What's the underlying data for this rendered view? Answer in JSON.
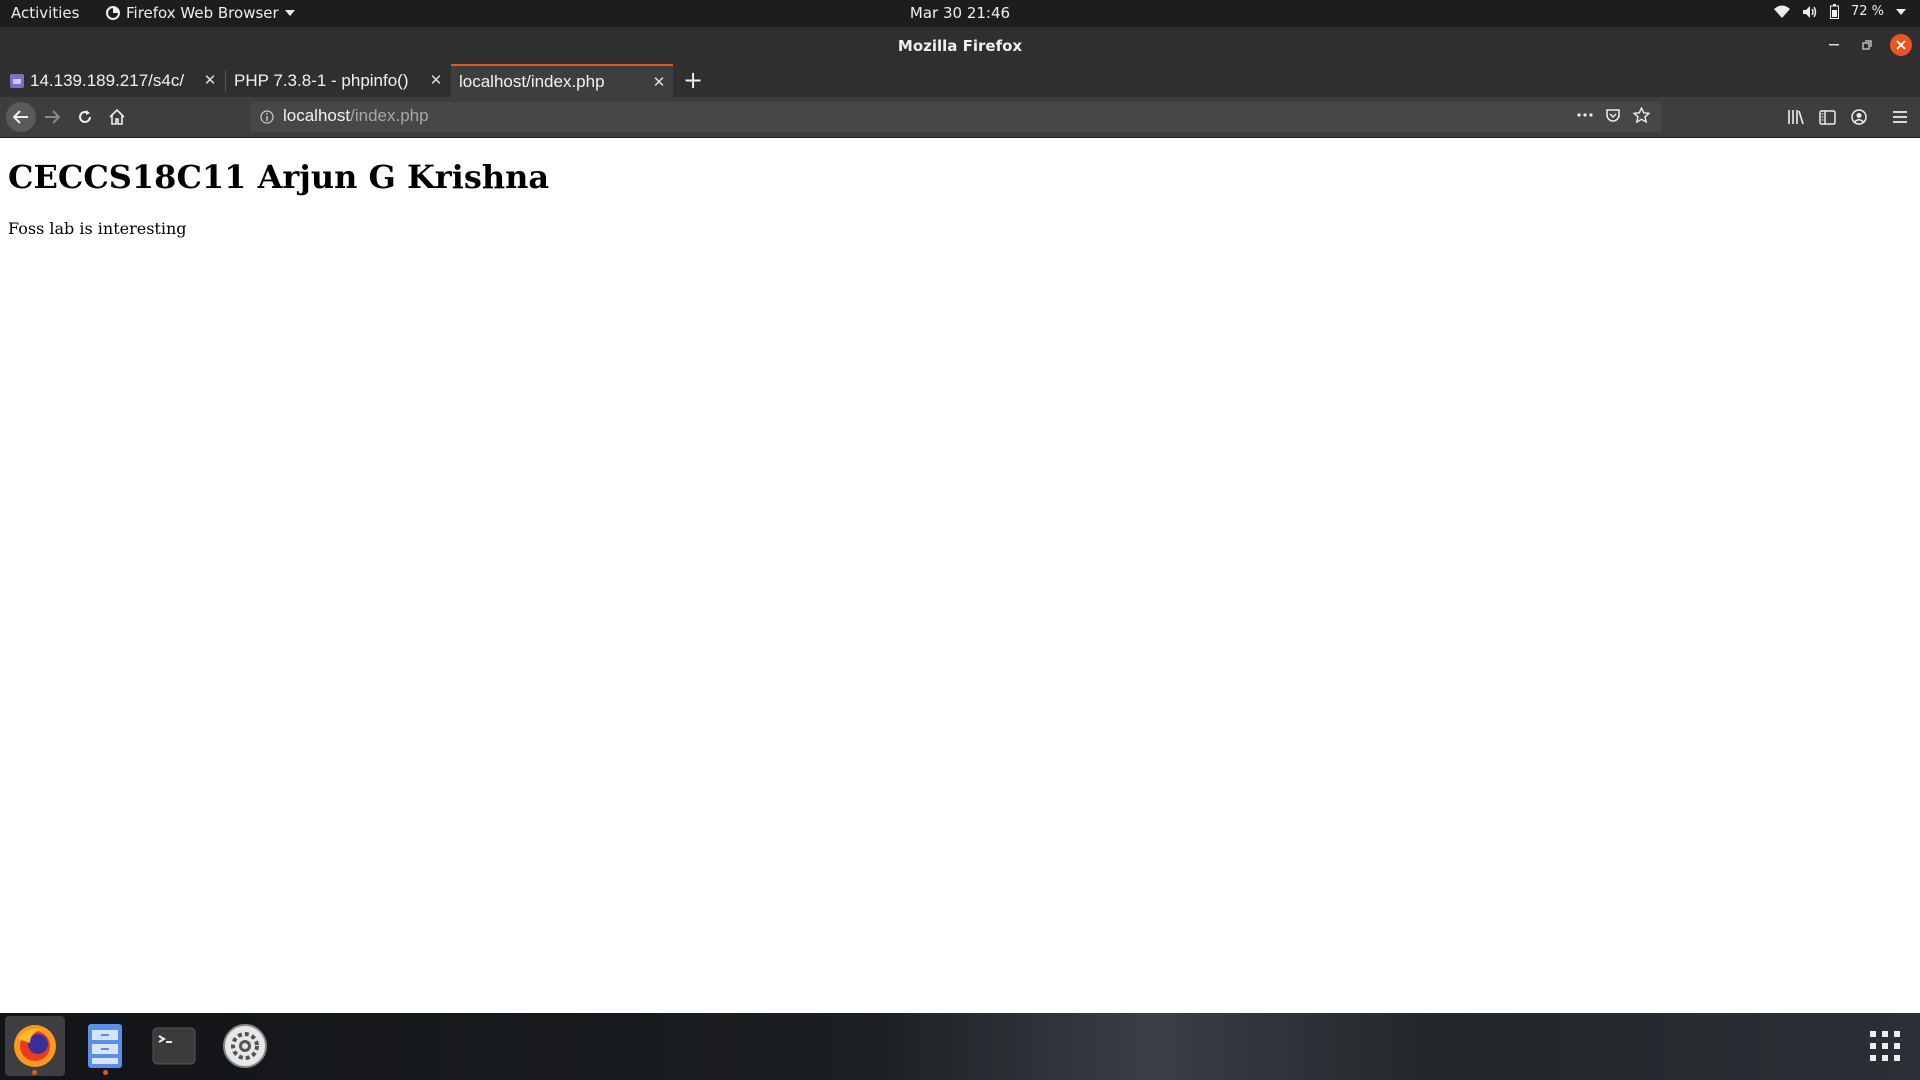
{
  "topbar": {
    "activities": "Activities",
    "app_name": "Firefox Web Browser",
    "clock": "Mar 30  21:46",
    "battery": "72 %"
  },
  "window": {
    "title": "Mozilla Firefox"
  },
  "tabs": [
    {
      "label": "14.139.189.217/s4c/",
      "active": false
    },
    {
      "label": "PHP 7.3.8-1 - phpinfo()",
      "active": false
    },
    {
      "label": "localhost/index.php",
      "active": true
    }
  ],
  "urlbar": {
    "host": "localhost",
    "path": "/index.php"
  },
  "page": {
    "heading": "CECCS18C11 Arjun G Krishna",
    "paragraph": "Foss lab is interesting"
  },
  "colors": {
    "accent": "#e25920",
    "close_button": "#e95420"
  },
  "dock": {
    "items": [
      "firefox-icon",
      "files-icon",
      "terminal-icon",
      "settings-icon",
      "show-apps-icon"
    ]
  }
}
